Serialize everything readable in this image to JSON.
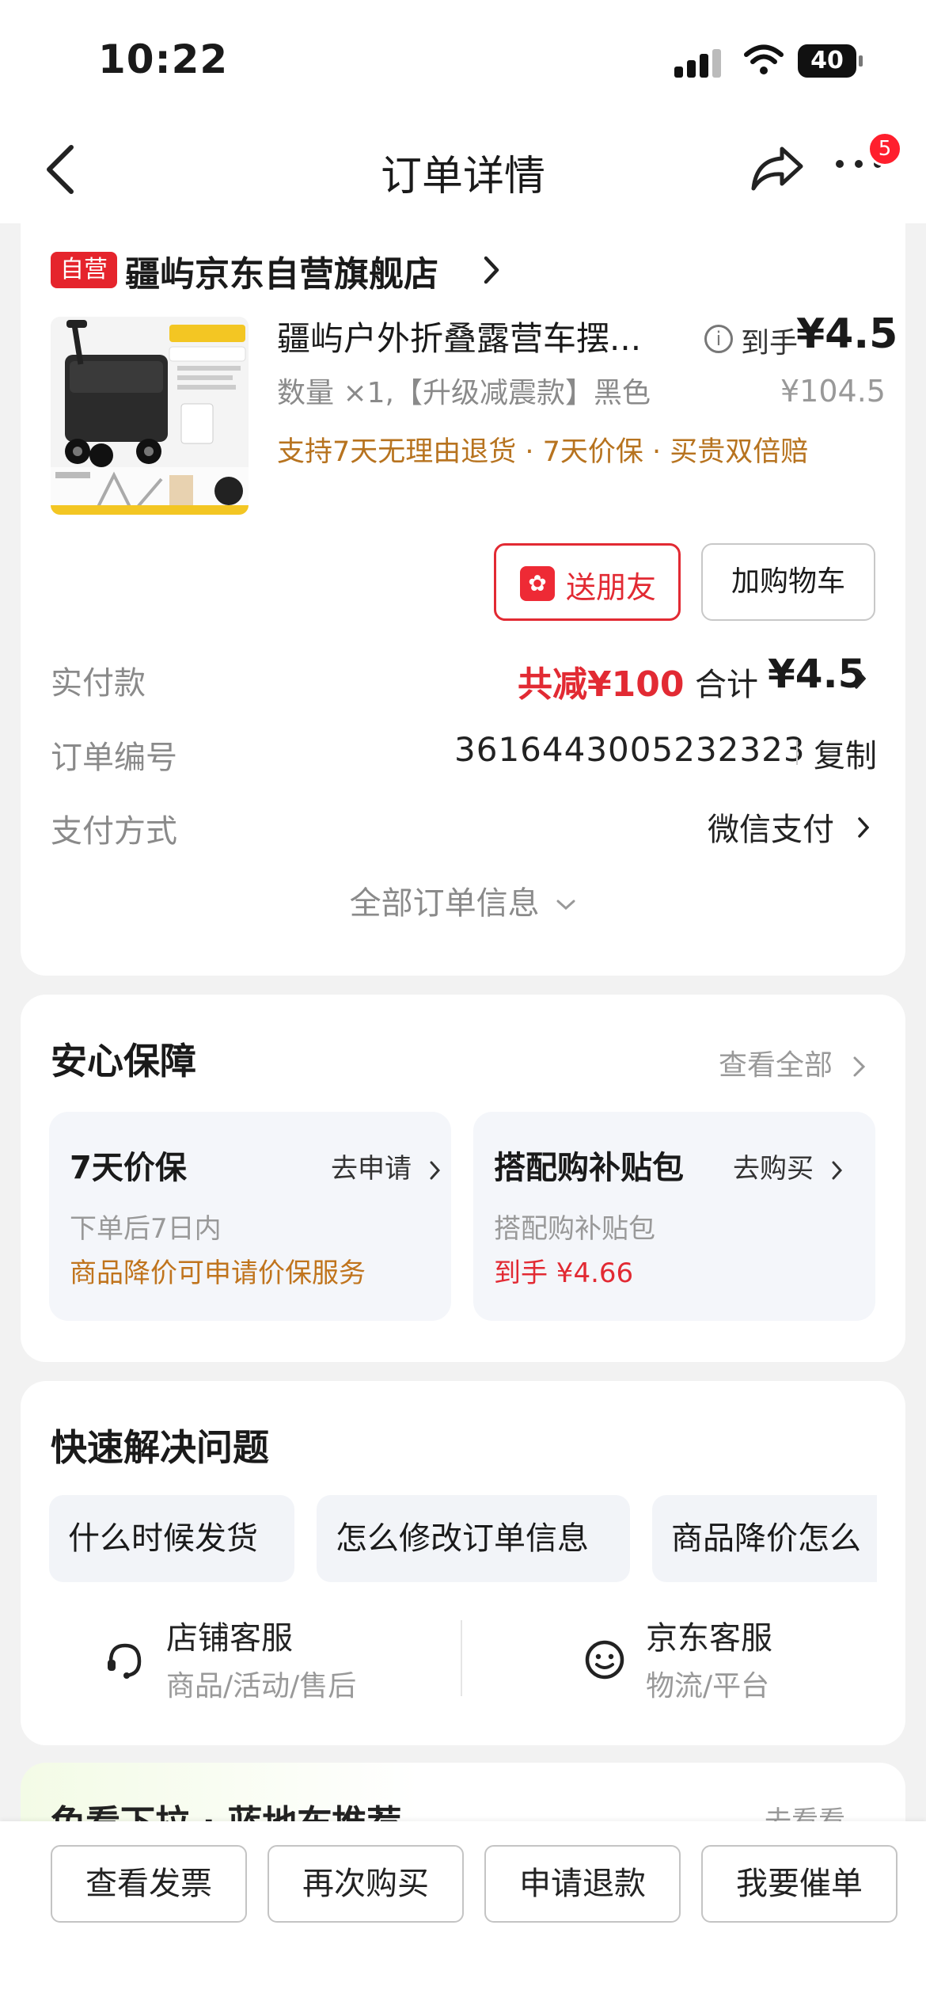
{
  "status_bar": {
    "time": "10:22",
    "battery": "40"
  },
  "nav": {
    "title": "订单详情",
    "badge": "5"
  },
  "order": {
    "self_tag": "自营",
    "store_name": "疆屿京东自营旗舰店",
    "product": {
      "title": "疆屿户外折叠露营车摆...",
      "spec": "数量 ×1,【升级减震款】黑色",
      "promise": "支持7天无理由退货 · 7天价保 · 买贵双倍赔",
      "daoshou_label": "到手",
      "price": "¥4.5",
      "original_price": "¥104.5"
    },
    "buttons": {
      "gift": "送朋友",
      "cart": "加购物车"
    },
    "paid": {
      "label": "实付款",
      "saved": "共减¥100",
      "total_label": "合计",
      "total": "¥4.5"
    },
    "order_no": {
      "label": "订单编号",
      "value": "3616443005232323",
      "copy": "复制"
    },
    "pay_method": {
      "label": "支付方式",
      "value": "微信支付"
    },
    "all_info": "全部订单信息"
  },
  "guarantee": {
    "title": "安心保障",
    "view_all": "查看全部",
    "items": [
      {
        "title": "7天价保",
        "action": "去申请",
        "sub": "下单后7日内",
        "note": "商品降价可申请价保服务",
        "note_color": "#c0741d"
      },
      {
        "title": "搭配购补贴包",
        "action": "去购买",
        "sub": "搭配购补贴包",
        "note": "到手 ¥4.66",
        "note_color": "#e22a33"
      }
    ]
  },
  "quick": {
    "title": "快速解决问题",
    "chips": [
      "什么时候发货",
      "怎么修改订单信息",
      "商品降价怎么"
    ],
    "service": [
      {
        "title": "店铺客服",
        "sub": "商品/活动/售后",
        "icon": "headset-icon"
      },
      {
        "title": "京东客服",
        "sub": "物流/平台",
        "icon": "smile-icon"
      }
    ]
  },
  "recommend": {
    "title": "免看下拉 · 蓝地布推荐",
    "more": "去看看"
  },
  "bottom_bar": {
    "buttons": [
      "查看发票",
      "再次购买",
      "申请退款",
      "我要催单"
    ]
  }
}
